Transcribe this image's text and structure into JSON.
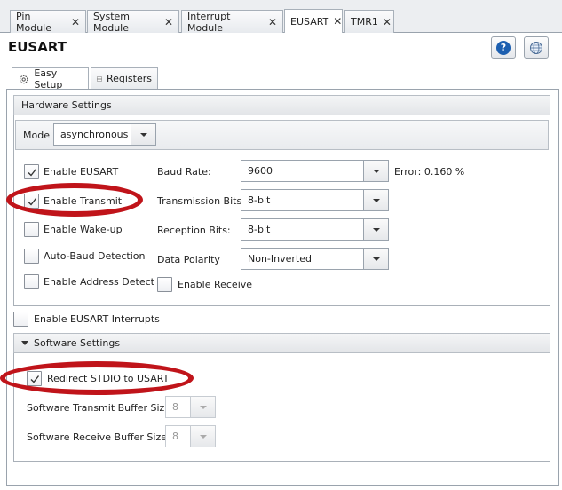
{
  "tabs": [
    {
      "label": "Pin Module",
      "active": false
    },
    {
      "label": "System Module",
      "active": false
    },
    {
      "label": "Interrupt Module",
      "active": false
    },
    {
      "label": "EUSART",
      "active": true
    },
    {
      "label": "TMR1",
      "active": false
    }
  ],
  "close_glyph": "✕",
  "header": {
    "title": "EUSART",
    "help_icon": "help-icon",
    "web_icon": "globe-icon",
    "help_glyph": "?"
  },
  "subtabs": [
    {
      "label": "Easy Setup",
      "icon": "gear-icon",
      "active": true
    },
    {
      "label": "Registers",
      "icon": "table-icon",
      "active": false
    }
  ],
  "hardware": {
    "title": "Hardware Settings",
    "mode_label": "Mode",
    "mode_value": "asynchronous",
    "checkboxes": [
      {
        "label": "Enable EUSART",
        "checked": true
      },
      {
        "label": "Enable Transmit",
        "checked": true
      },
      {
        "label": "Enable Wake-up",
        "checked": false
      },
      {
        "label": "Auto-Baud Detection",
        "checked": false
      },
      {
        "label": "Enable Address Detect",
        "checked": false
      }
    ],
    "baud_label": "Baud Rate:",
    "baud_value": "9600",
    "error_text": "Error: 0.160 %",
    "tx_bits_label": "Transmission Bits:",
    "tx_bits_value": "8-bit",
    "rx_bits_label": "Reception Bits:",
    "rx_bits_value": "8-bit",
    "polarity_label": "Data Polarity",
    "polarity_value": "Non-Inverted",
    "enable_receive_label": "Enable Receive",
    "enable_receive_checked": false
  },
  "interrupts": {
    "label": "Enable EUSART Interrupts",
    "checked": false
  },
  "software": {
    "title": "Software Settings",
    "redirect_label": "Redirect STDIO to USART",
    "redirect_checked": true,
    "tx_buffer_label": "Software Transmit Buffer Size",
    "tx_buffer_value": "8",
    "rx_buffer_label": "Software Receive Buffer Size",
    "rx_buffer_value": "8"
  },
  "colors": {
    "highlight_ring": "#c0141a",
    "help_blue": "#1c5fb0"
  }
}
